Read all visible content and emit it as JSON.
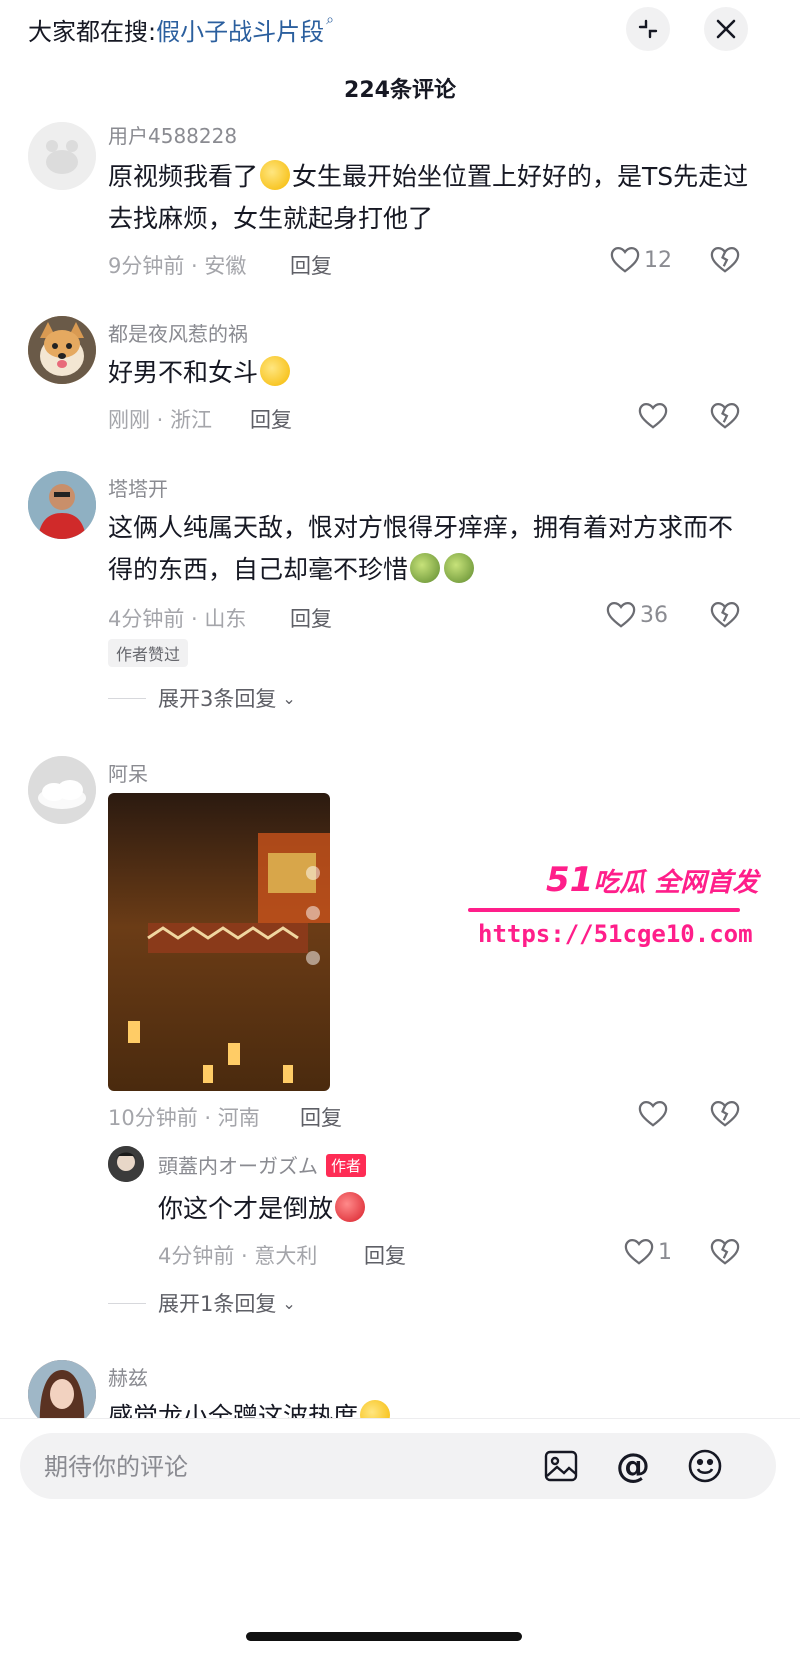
{
  "header": {
    "search_label": "大家都在搜:",
    "search_query": "假小子战斗片段",
    "comment_count": "224条评论"
  },
  "comments": [
    {
      "username": "用户4588228",
      "text_before_emoji": "原视频我看了",
      "text_after_emoji": "女生最开始坐位置上好好的，是TS先走过去找麻烦，女生就起身打他了",
      "time_location": "9分钟前 · 安徽",
      "reply_label": "回复",
      "like_count": "12"
    },
    {
      "username": "都是夜风惹的祸",
      "text": "好男不和女斗",
      "time_location": "刚刚 · 浙江",
      "reply_label": "回复",
      "like_count": ""
    },
    {
      "username": "塔塔开",
      "text": "这俩人纯属天敌，恨对方恨得牙痒痒，拥有着对方求而不得的东西，自己却毫不珍惜",
      "time_location": "4分钟前 · 山东",
      "reply_label": "回复",
      "like_count": "36",
      "badge": "作者赞过",
      "expand_label": "展开3条回复"
    },
    {
      "username": "阿呆",
      "time_location": "10分钟前 · 河南",
      "reply_label": "回复",
      "like_count": "",
      "expand_label": "展开1条回复",
      "reply": {
        "username": "頭蓋内オーガズム",
        "author_badge": "作者",
        "text": "你这个才是倒放",
        "time_location": "4分钟前 · 意大利",
        "reply_label": "回复",
        "like_count": "1"
      }
    },
    {
      "username": "赫兹",
      "text": "感觉龙小全蹭这波热度"
    }
  ],
  "watermark": {
    "brand_number": "51",
    "brand_text": "吃瓜 全网首发",
    "url": "https://51cge10.com"
  },
  "composer": {
    "placeholder": "期待你的评论"
  },
  "colors": {
    "accent_link": "#2b5f9e",
    "author_badge": "#fe2c55",
    "watermark": "#ff1e8a"
  }
}
